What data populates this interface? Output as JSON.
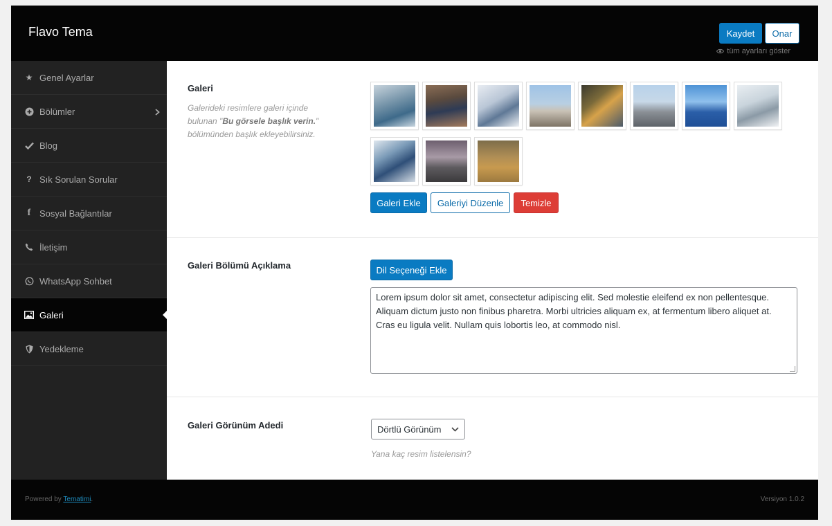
{
  "header": {
    "title": "Flavo Tema",
    "save_label": "Kaydet",
    "reset_label": "Onar",
    "show_all_label": "tüm ayarları göster"
  },
  "sidebar": {
    "items": [
      {
        "label": "Genel Ayarlar",
        "icon": "star-icon"
      },
      {
        "label": "Bölümler",
        "icon": "plus-circle-icon"
      },
      {
        "label": "Blog",
        "icon": "check-icon"
      },
      {
        "label": "Sık Sorulan Sorular",
        "icon": "question-icon"
      },
      {
        "label": "Sosyal Bağlantılar",
        "icon": "facebook-icon"
      },
      {
        "label": "İletişim",
        "icon": "phone-icon"
      },
      {
        "label": "WhatsApp Sohbet",
        "icon": "whatsapp-icon"
      },
      {
        "label": "Galeri",
        "icon": "image-icon"
      },
      {
        "label": "Yedekleme",
        "icon": "shield-icon"
      }
    ],
    "active": "Galeri"
  },
  "gallery": {
    "label": "Galeri",
    "desc_before": "Galerideki resimlere galeri içinde bulunan \"",
    "desc_bold": "Bu görsele başlık verin.",
    "desc_after": "\" bölümünden başlık ekleyebilirsiniz.",
    "add_label": "Galeri Ekle",
    "edit_label": "Galeriyi Düzenle",
    "clear_label": "Temizle",
    "thumbnails": [
      "factory-workers",
      "man-presenting",
      "documents-hands",
      "power-plant",
      "engineer-tablet",
      "refinery",
      "solar-wind",
      "lab-scientists",
      "worker-machinery",
      "industrial-smoke",
      "harvest-field"
    ]
  },
  "description": {
    "label": "Galeri Bölümü Açıklama",
    "add_lang_label": "Dil Seçeneği Ekle",
    "text": "Lorem ipsum dolor sit amet, consectetur adipiscing elit. Sed molestie eleifend ex non pellentesque. Aliquam dictum justo non finibus pharetra. Morbi ultricies aliquam ex, at fermentum libero aliquet at. Cras eu ligula velit. Nullam quis lobortis leo, at commodo nisl."
  },
  "view_count": {
    "label": "Galeri Görünüm Adedi",
    "selected": "Dörtlü Görünüm",
    "hint": "Yana kaç resim listelensin?"
  },
  "footer": {
    "powered_prefix": "Powered by ",
    "powered_link": "Tematimi",
    "powered_suffix": ".",
    "version": "Versiyon 1.0.2"
  },
  "colors": {
    "accent": "#0a7bc2",
    "danger": "#dd3d36",
    "dark": "#050505",
    "sidebar": "#222222"
  }
}
